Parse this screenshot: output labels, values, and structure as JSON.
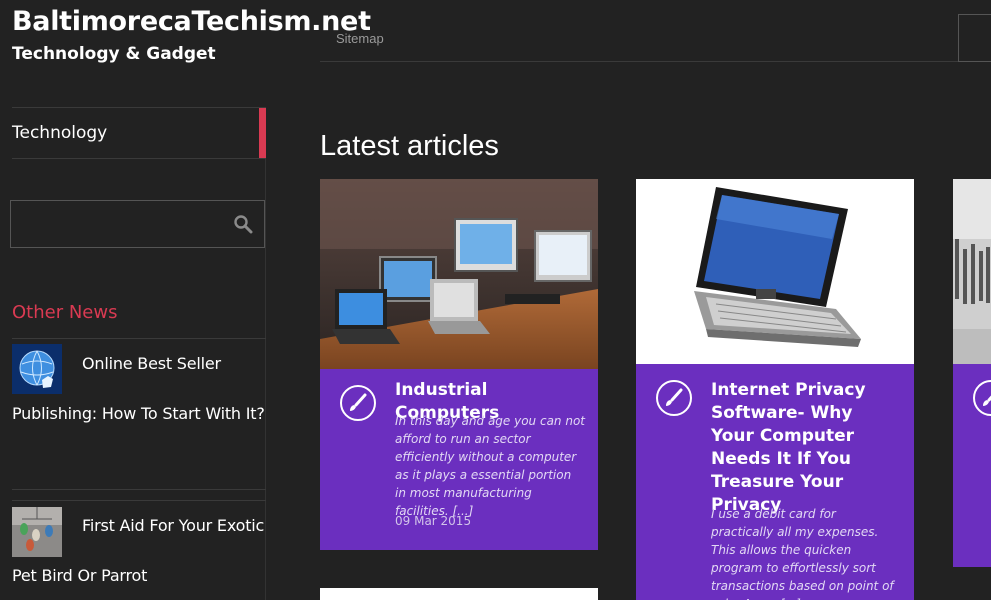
{
  "site": {
    "title": "BaltimorecaTechism.net",
    "tagline": "Technology & Gadget"
  },
  "topbar": {
    "sitemap_label": "Sitemap"
  },
  "sidebar": {
    "nav": [
      {
        "label": "Technology"
      }
    ],
    "search": {
      "placeholder": "",
      "value": ""
    },
    "other_news": {
      "title": "Other News",
      "items": [
        {
          "title": "Online Best Seller Publishing: How To Start With It?",
          "thumb_icon": "globe-hand-icon"
        },
        {
          "title": "First Aid For Your Exotic Pet Bird Or Parrot",
          "thumb_icon": "birds-mobile-icon"
        }
      ]
    }
  },
  "main": {
    "section_title": "Latest articles",
    "articles": [
      {
        "title": "Industrial Computers",
        "excerpt": "In this day and age you can not afford to run an sector efficiently without a computer as it plays a essential portion in most manufacturing facilities. [...]",
        "date": "09 Mar 2015",
        "icon": "brush-icon"
      },
      {
        "title": "Internet Privacy Software- Why Your Computer Needs It If You Treasure Your Privacy",
        "excerpt": "I use a debit card for practically all my expenses. This allows the quicken program to effortlessly sort transactions based on point of sale. As an [...]",
        "date": "",
        "icon": "brush-icon"
      },
      {
        "title": "",
        "excerpt": "",
        "date": "",
        "icon": "brush-icon"
      }
    ]
  },
  "colors": {
    "background": "#222222",
    "accent_red": "#d93a52",
    "card_purple": "#6b2fbf"
  }
}
